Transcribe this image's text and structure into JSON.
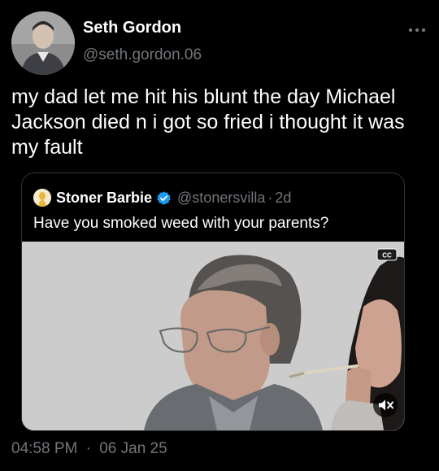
{
  "author": {
    "name": "Seth Gordon",
    "handle": "@seth.gordon.06"
  },
  "tweet": {
    "text": "my dad let me hit his blunt the day Michael Jackson died n i got so fried i thought it was my fault",
    "time": "04:58 PM",
    "separator": "·",
    "date": "06 Jan 25"
  },
  "quoted": {
    "name": "Stoner Barbie",
    "handle": "@stonersvilla",
    "separator": "·",
    "age": "2d",
    "text": "Have you smoked weed with your parents?",
    "media": {
      "cc_label": "CC"
    }
  },
  "icons": {
    "more": "more-horizontal-icon",
    "verified": "verified-badge-icon",
    "muted": "speaker-muted-icon",
    "captions": "closed-captions-icon"
  },
  "colors": {
    "background": "#000000",
    "text": "#ffffff",
    "secondary_text": "#71767b",
    "border": "#2f3336",
    "verified_blue": "#1d9bf0"
  }
}
